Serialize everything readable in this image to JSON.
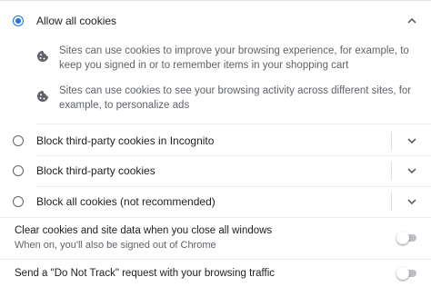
{
  "cookie_options": [
    {
      "label": "Allow all cookies",
      "selected": true,
      "expanded": true
    },
    {
      "label": "Block third-party cookies in Incognito",
      "selected": false,
      "expanded": false
    },
    {
      "label": "Block third-party cookies",
      "selected": false,
      "expanded": false
    },
    {
      "label": "Block all cookies (not recommended)",
      "selected": false,
      "expanded": false
    }
  ],
  "allow_all_details": [
    {
      "icon": "cookie-icon",
      "text": "Sites can use cookies to improve your browsing experience, for example, to keep you signed in or to remember items in your shopping cart"
    },
    {
      "icon": "cookie-icon",
      "text": "Sites can use cookies to see your browsing activity across different sites, for example, to personalize ads"
    }
  ],
  "settings": {
    "clear_on_exit": {
      "title": "Clear cookies and site data when you close all windows",
      "subtitle": "When on, you'll also be signed out of Chrome",
      "enabled": false
    },
    "do_not_track": {
      "title": "Send a \"Do Not Track\" request with your browsing traffic",
      "enabled": false
    }
  },
  "colors": {
    "accent": "#1a73e8",
    "text": "#202124",
    "secondary_text": "#5f6368",
    "toggle_off": "#bdc1c6"
  }
}
